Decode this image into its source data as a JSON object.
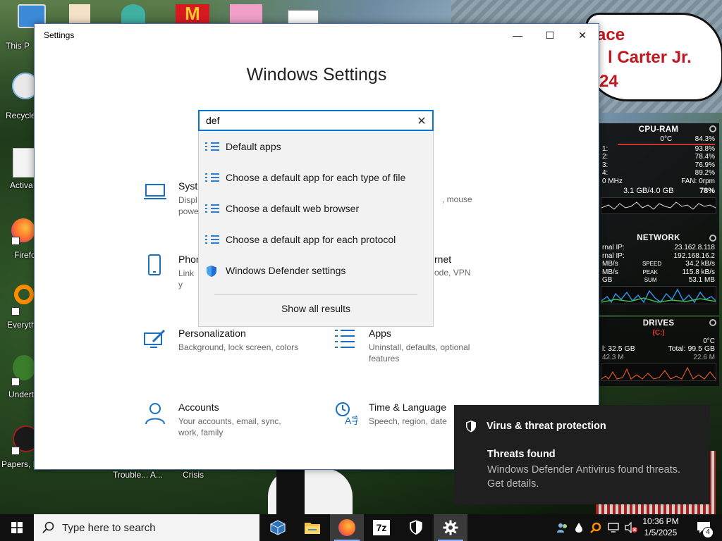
{
  "desktop": {
    "icons": [
      {
        "label": "This P"
      },
      {
        "label": "Recycle"
      },
      {
        "label": "Activa"
      },
      {
        "label": "Firefo"
      },
      {
        "label": "Everyth"
      },
      {
        "label": "Undert"
      },
      {
        "label": "Papers, P"
      }
    ],
    "bottom_labels": [
      "Trouble... A...",
      "Crisis"
    ],
    "sign_lines": [
      "ace",
      "l Carter Jr.",
      "24"
    ]
  },
  "gadgets": {
    "cpu": {
      "title": "CPU-RAM",
      "rows": [
        {
          "left": "",
          "mid": "0°C",
          "right": "84.3%"
        },
        {
          "left": "1:",
          "mid": "",
          "right": "93.8%"
        },
        {
          "left": "2:",
          "mid": "",
          "right": "78.4%"
        },
        {
          "left": "3:",
          "mid": "",
          "right": "76.9%"
        },
        {
          "left": "4:",
          "mid": "",
          "right": "89.2%"
        },
        {
          "left": "0 MHz",
          "mid": "",
          "right": "FAN: 0rpm"
        }
      ],
      "mem": {
        "used": "3.1 GB/4.0 GB",
        "pct": "78%"
      }
    },
    "network": {
      "title": "NETWORK",
      "rows": [
        {
          "left": "rnal IP:",
          "right": "23.162.8.118"
        },
        {
          "left": "rnal IP:",
          "right": "192.168.16.2"
        },
        {
          "left": "MB/s",
          "mid": "SPEED",
          "right": "34.2 kB/s"
        },
        {
          "left": "MB/s",
          "mid": "PEAK",
          "right": "115.8 kB/s"
        },
        {
          "left": "GB",
          "mid": "SUM",
          "right": "53.1 MB"
        }
      ]
    },
    "drives": {
      "title": "DRIVES",
      "rows": [
        {
          "left": "",
          "mid": "(C:)",
          "right": ""
        },
        {
          "left": "",
          "mid": "",
          "right": "0°C"
        },
        {
          "left": "l: 32.5 GB",
          "mid": "",
          "right": "Total: 99.5 GB"
        },
        {
          "left": "42.3 M",
          "mid": "",
          "right": "22.6 M"
        }
      ]
    }
  },
  "window": {
    "title": "Settings",
    "heading": "Windows Settings",
    "controls": {
      "minimize": "—",
      "maximize": "☐",
      "close": "✕"
    },
    "search": {
      "value": "def",
      "clear": "✕"
    },
    "suggestions": [
      {
        "label": "Default apps",
        "icon": "list-icon"
      },
      {
        "label": "Choose a default app for each type of file",
        "icon": "list-icon"
      },
      {
        "label": "Choose a default web browser",
        "icon": "list-icon"
      },
      {
        "label": "Choose a default app for each protocol",
        "icon": "list-icon"
      },
      {
        "label": "Windows Defender settings",
        "icon": "shield-icon"
      }
    ],
    "show_all": "Show all results",
    "categories": [
      {
        "name": "Syste",
        "desc": "Displ\npowe",
        "icon": "laptop-icon"
      },
      {
        "name": "",
        "desc": ", mouse",
        "icon": ""
      },
      {
        "name": "Phon",
        "desc": "Link y",
        "icon": "phone-icon"
      },
      {
        "name": "rnet",
        "desc": "ode, VPN",
        "icon": ""
      },
      {
        "name": "Personalization",
        "desc": "Background, lock screen, colors",
        "icon": "paint-icon"
      },
      {
        "name": "Apps",
        "desc": "Uninstall, defaults, optional features",
        "icon": "apps-list-icon"
      },
      {
        "name": "Accounts",
        "desc": "Your accounts, email, sync, work, family",
        "icon": "person-icon"
      },
      {
        "name": "Time & Language",
        "desc": "Speech, region, date",
        "icon": "time-language-icon"
      }
    ]
  },
  "toast": {
    "header": "Virus & threat protection",
    "title": "Threats found",
    "body": "Windows Defender Antivirus found threats. Get details."
  },
  "taskbar": {
    "search_placeholder": "Type here to search",
    "apps": [
      "virtualbox-icon",
      "file-explorer-icon",
      "firefox-icon",
      "7zip-icon",
      "defender-shield-icon",
      "settings-gear-icon"
    ],
    "seven_zip_label": "7z",
    "time": "10:36 PM",
    "date": "1/5/2025",
    "notification_count": "4"
  }
}
